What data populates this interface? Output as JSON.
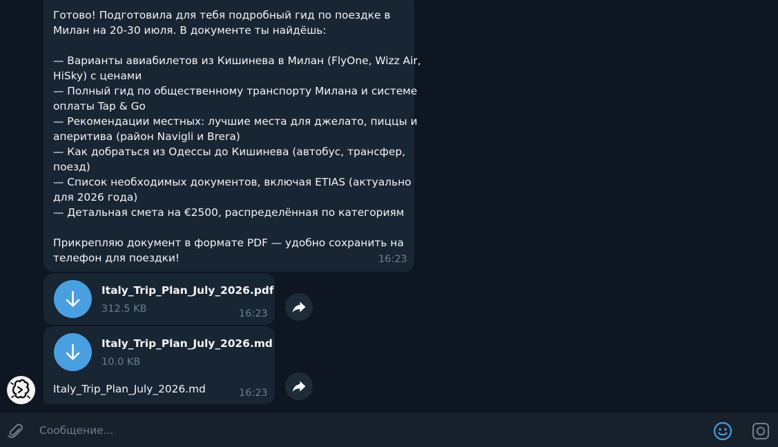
{
  "message": {
    "lines": [
      "Готово! Подготовила для тебя подробный гид по поездке в",
      "Милан на 20-30 июля. В документе ты найдёшь:",
      "",
      "— Варианты авиабилетов из Кишинева в Милан (FlyOne, Wizz Air,",
      "HiSky) с ценами",
      "— Полный гид по общественному транспорту Милана и системе",
      "оплаты Tap & Go",
      "— Рекомендации местных: лучшие места для джелато, пиццы и",
      "аперитива (район Navigli и Brera)",
      "— Как добраться из Одессы до Кишинева (автобус, трансфер,",
      "поезд)",
      "— Список необходимых документов, включая ETIAS (актуально",
      "для 2026 года)",
      "— Детальная смета на €2500, распределённая по категориям",
      "",
      "Прикрепляю документ в формате PDF — удобно сохранить на",
      "телефон для поездки!"
    ],
    "time": "16:23"
  },
  "files": [
    {
      "name": "Italy_Trip_Plan_July_2026.pdf",
      "size": "312.5 KB",
      "time": "16:23",
      "icon": "download-arrow-icon"
    },
    {
      "name": "Italy_Trip_Plan_July_2026.md",
      "size": "10.0 KB",
      "caption": "Italy_Trip_Plan_July_2026.md",
      "time": "16:23",
      "icon": "download-arrow-icon"
    }
  ],
  "composer": {
    "placeholder": "Сообщение...",
    "value": "",
    "icons": [
      "paperclip-icon",
      "emoji-icon",
      "camera-icon"
    ]
  },
  "colors": {
    "background": "#0e1621",
    "bubble": "#182533",
    "accent": "#4a9fe0",
    "muted_text": "#6d7f8f",
    "composer_bg": "#17212b"
  }
}
